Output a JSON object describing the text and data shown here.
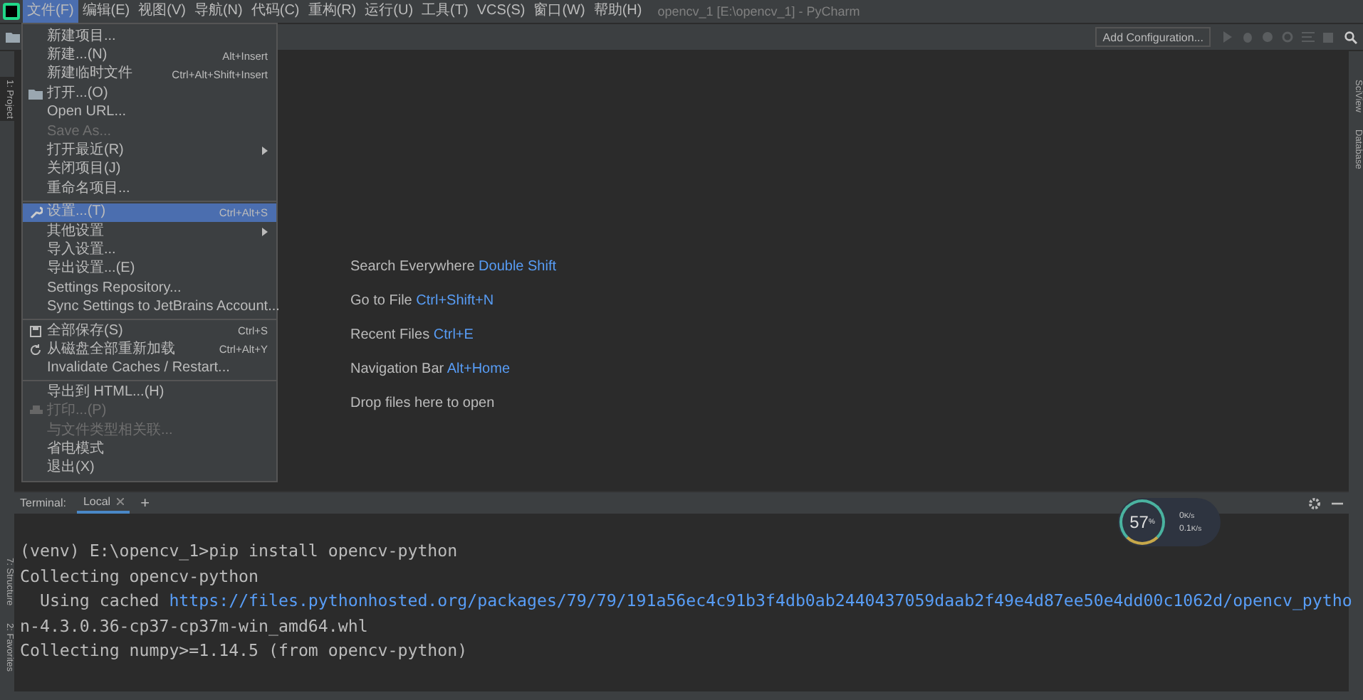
{
  "window": {
    "title": "opencv_1 [E:\\opencv_1] - PyCharm"
  },
  "menu_bar": [
    {
      "label": "文件(F)",
      "selected": true
    },
    {
      "label": "编辑(E)",
      "selected": false
    },
    {
      "label": "视图(V)",
      "selected": false
    },
    {
      "label": "导航(N)",
      "selected": false
    },
    {
      "label": "代码(C)",
      "selected": false
    },
    {
      "label": "重构(R)",
      "selected": false
    },
    {
      "label": "运行(U)",
      "selected": false
    },
    {
      "label": "工具(T)",
      "selected": false
    },
    {
      "label": "VCS(S)",
      "selected": false
    },
    {
      "label": "窗口(W)",
      "selected": false
    },
    {
      "label": "帮助(H)",
      "selected": false
    }
  ],
  "file_menu": {
    "items": [
      {
        "kind": "item",
        "label": "新建项目...",
        "selected": false,
        "disabled": false
      },
      {
        "kind": "item",
        "label": "新建...(N)",
        "shortcut": "Alt+Insert",
        "selected": false,
        "disabled": false
      },
      {
        "kind": "item",
        "label": "新建临时文件",
        "shortcut": "Ctrl+Alt+Shift+Insert",
        "selected": false,
        "disabled": false
      },
      {
        "kind": "item",
        "label": "打开...(O)",
        "selected": false,
        "disabled": false
      },
      {
        "kind": "item",
        "label": "Open URL...",
        "selected": false,
        "disabled": false
      },
      {
        "kind": "item",
        "label": "Save As...",
        "selected": false,
        "disabled": true
      },
      {
        "kind": "item",
        "label": "打开最近(R)",
        "submenu": true,
        "selected": false,
        "disabled": false
      },
      {
        "kind": "item",
        "label": "关闭项目(J)",
        "selected": false,
        "disabled": false
      },
      {
        "kind": "item",
        "label": "重命名项目...",
        "selected": false,
        "disabled": false
      },
      {
        "kind": "separator"
      },
      {
        "kind": "item",
        "label": "设置...(T)",
        "shortcut": "Ctrl+Alt+S",
        "selected": true,
        "disabled": false
      },
      {
        "kind": "item",
        "label": "其他设置",
        "submenu": true,
        "selected": false,
        "disabled": false
      },
      {
        "kind": "item",
        "label": "导入设置...",
        "selected": false,
        "disabled": false
      },
      {
        "kind": "item",
        "label": "导出设置...(E)",
        "selected": false,
        "disabled": false
      },
      {
        "kind": "item",
        "label": "Settings Repository...",
        "selected": false,
        "disabled": false
      },
      {
        "kind": "item",
        "label": "Sync Settings to JetBrains Account...",
        "selected": false,
        "disabled": false
      },
      {
        "kind": "separator"
      },
      {
        "kind": "item",
        "label": "全部保存(S)",
        "shortcut": "Ctrl+S",
        "selected": false,
        "disabled": false
      },
      {
        "kind": "item",
        "label": "从磁盘全部重新加载",
        "shortcut": "Ctrl+Alt+Y",
        "selected": false,
        "disabled": false
      },
      {
        "kind": "item",
        "label": "Invalidate Caches / Restart...",
        "selected": false,
        "disabled": false
      },
      {
        "kind": "separator"
      },
      {
        "kind": "item",
        "label": "导出到 HTML...(H)",
        "selected": false,
        "disabled": false
      },
      {
        "kind": "item",
        "label": "打印...(P)",
        "selected": false,
        "disabled": true
      },
      {
        "kind": "item",
        "label": "与文件类型相关联...",
        "selected": false,
        "disabled": true
      },
      {
        "kind": "item",
        "label": "省电模式",
        "selected": false,
        "disabled": false
      },
      {
        "kind": "item",
        "label": "退出(X)",
        "selected": false,
        "disabled": false
      }
    ]
  },
  "toolbar": {
    "run_configuration": "Add Configuration..."
  },
  "left_tool_tabs": [
    {
      "label": "1: Project",
      "selected": true
    },
    {
      "label": "7: Structure",
      "selected": false
    },
    {
      "label": "2: Favorites",
      "selected": false
    }
  ],
  "right_tool_tabs": [
    {
      "label": "SciView",
      "selected": false
    },
    {
      "label": "Database",
      "selected": false
    }
  ],
  "editor_hints": [
    {
      "action": "Search Everywhere",
      "shortcut": "Double Shift"
    },
    {
      "action": "Go to File",
      "shortcut": "Ctrl+Shift+N"
    },
    {
      "action": "Recent Files",
      "shortcut": "Ctrl+E"
    },
    {
      "action": "Navigation Bar",
      "shortcut": "Alt+Home"
    },
    {
      "action": "Drop files here to open"
    }
  ],
  "terminal": {
    "title": "Terminal:",
    "tabs": [
      {
        "label": "Local",
        "selected": true
      }
    ],
    "add": "+",
    "lines": [
      {
        "text": "(venv) E:\\opencv_1>pip install opencv-python"
      },
      {
        "text": "Collecting opencv-python"
      },
      {
        "text": "  Using cached ",
        "link": "https://files.pythonhosted.org/packages/79/79/191a56ec4c91b3f4db0ab2440437059daab2f49e4d87ee50e4dd00c1062d/opencv_pytho"
      },
      {
        "text": "n-4.3.0.36-cp37-cp37m-win_amd64.whl"
      },
      {
        "text": "Collecting numpy>=1.14.5 (from opencv-python)"
      }
    ]
  },
  "monitor": {
    "value": "57",
    "unit": "%",
    "rates": [
      {
        "value": "0",
        "unit": "K/s"
      },
      {
        "value": "0.1",
        "unit": "K/s"
      }
    ]
  }
}
